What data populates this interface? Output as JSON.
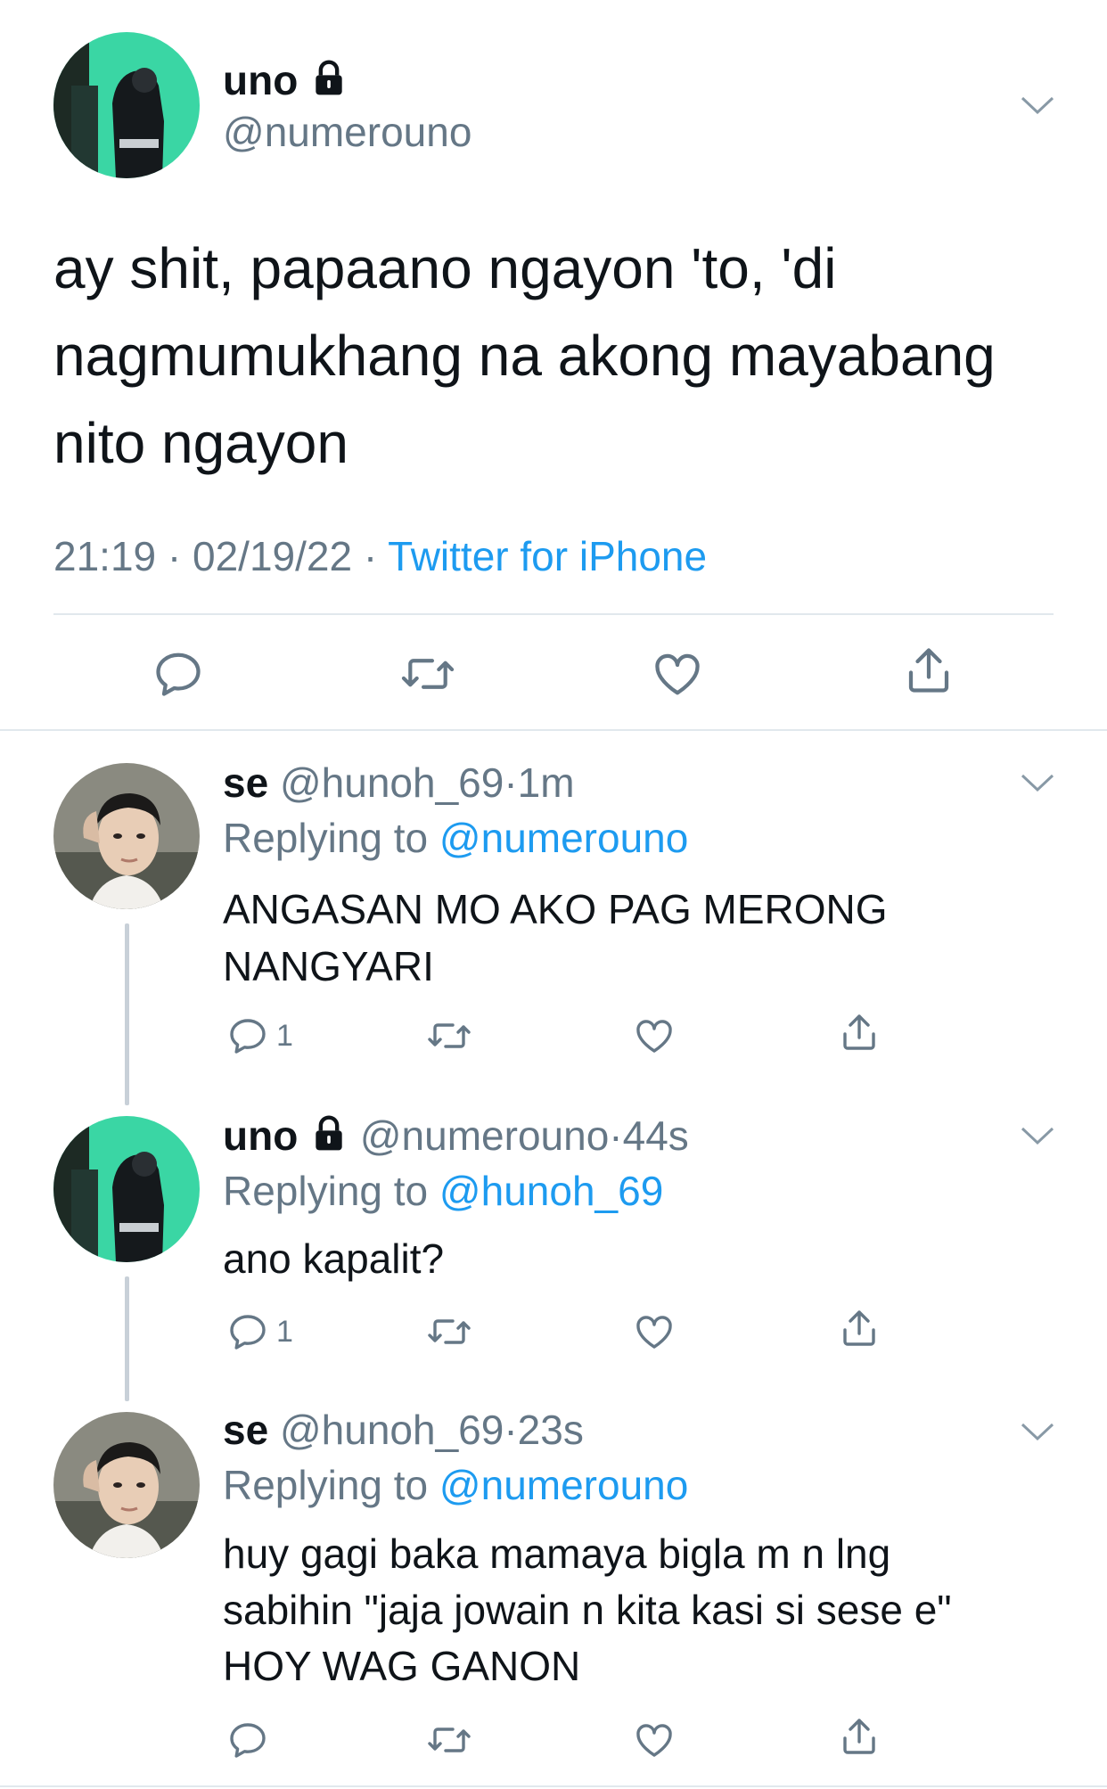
{
  "main_tweet": {
    "display_name": "uno",
    "handle": "@numerouno",
    "text_lines": [
      "ay shit, papaano ngayon 'to, 'di",
      "nagmumukhang na akong mayabang",
      "nito ngayon"
    ],
    "time": "21:19",
    "date": "02/19/22",
    "source": "Twitter for iPhone"
  },
  "replies": [
    {
      "display_name": "se",
      "handle": "@hunoh_69",
      "age": "1m",
      "replying_label": "Replying to",
      "replying_to": "@numerouno",
      "text_lines": [
        "ANGASAN MO AKO PAG MERONG",
        "NANGYARI"
      ],
      "reply_count": "1"
    },
    {
      "display_name": "uno",
      "handle": "@numerouno",
      "age": "44s",
      "replying_label": "Replying to",
      "replying_to": "@hunoh_69",
      "text_lines": [
        "ano kapalit?"
      ],
      "reply_count": "1"
    },
    {
      "display_name": "se",
      "handle": "@hunoh_69",
      "age": "23s",
      "replying_label": "Replying to",
      "replying_to": "@numerouno",
      "text_lines": [
        "huy gagi baka mamaya bigla m n lng",
        "sabihin \"jaja jowain n kita kasi si sese e\"",
        "HOY WAG GANON"
      ],
      "reply_count": ""
    }
  ],
  "separator": "·",
  "colors": {
    "link": "#1d9bf0",
    "secondary": "#657786",
    "divider": "#e1e8ed",
    "thread_line": "#c8d0d8"
  },
  "icons": [
    "lock-icon",
    "chevron-down-icon",
    "reply-icon",
    "retweet-icon",
    "like-icon",
    "share-icon"
  ]
}
